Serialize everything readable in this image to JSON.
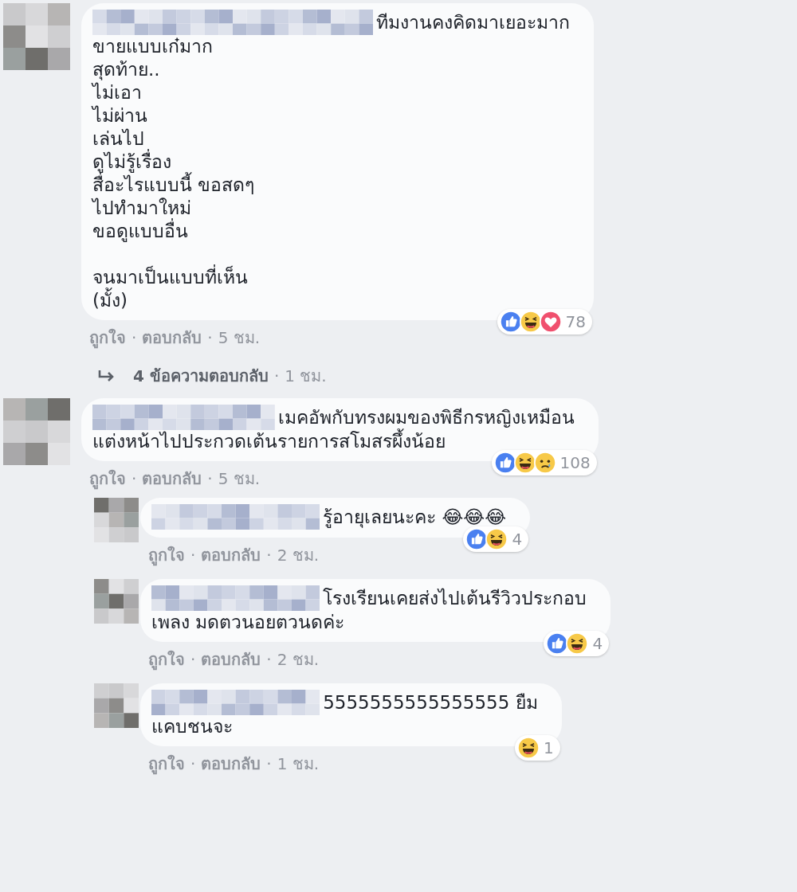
{
  "separator": "·",
  "comments": [
    {
      "first_line": "ทีมงานคงคิดมาเยอะมาก",
      "rest": "ขายแบบเก๋มาก\nสุดท้าย..\nไม่เอา\nไม่ผ่าน\nเล่นไป\nดูไม่รู้เรื่อง\nสื่อะไรแบบนี้ ขอสดๆ\nไปทำมาใหม่\nขอดูแบบอื่น\n\nจนมาเป็นแบบที่เห็น\n(มั้ง)",
      "reactions": [
        {
          "kind": "like"
        },
        {
          "kind": "haha"
        },
        {
          "kind": "love"
        }
      ],
      "reaction_count": "78",
      "actions": [
        "ถูกใจ",
        "ตอบกลับ"
      ],
      "time": "5 ชม.",
      "replies_summary": {
        "label": "4 ข้อความตอบกลับ",
        "time": "1 ชม."
      }
    },
    {
      "first_line": "เมคอัพกับทรงผมของพิธีกรหญิงเหมือน",
      "rest": "แต่งหน้าไปประกวดเต้นรายการสโมสรผึ้งน้อย",
      "reactions": [
        {
          "kind": "like"
        },
        {
          "kind": "haha"
        },
        {
          "kind": "sad"
        }
      ],
      "reaction_count": "108",
      "actions": [
        "ถูกใจ",
        "ตอบกลับ"
      ],
      "time": "5 ชม.",
      "replies": [
        {
          "first_line": "รู้อายุเลยนะคะ 😂😂😂",
          "reactions": [
            {
              "kind": "like"
            },
            {
              "kind": "haha"
            }
          ],
          "reaction_count": "4",
          "actions": [
            "ถูกใจ",
            "ตอบกลับ"
          ],
          "time": "2 ชม."
        },
        {
          "first_line": "โรงเรียนเคยส่งไปเต้นรีวิวประกอบ",
          "rest": "เพลง มดตวนอยตวนดค่ะ",
          "reactions": [
            {
              "kind": "like"
            },
            {
              "kind": "haha"
            }
          ],
          "reaction_count": "4",
          "actions": [
            "ถูกใจ",
            "ตอบกลับ"
          ],
          "time": "2 ชม."
        },
        {
          "first_line": "5555555555555555 ยืม",
          "rest": "แคบชนจะ",
          "reactions": [
            {
              "kind": "haha"
            }
          ],
          "reaction_count": "1",
          "actions": [
            "ถูกใจ",
            "ตอบกลับ"
          ],
          "time": "1 ชม."
        }
      ]
    }
  ]
}
